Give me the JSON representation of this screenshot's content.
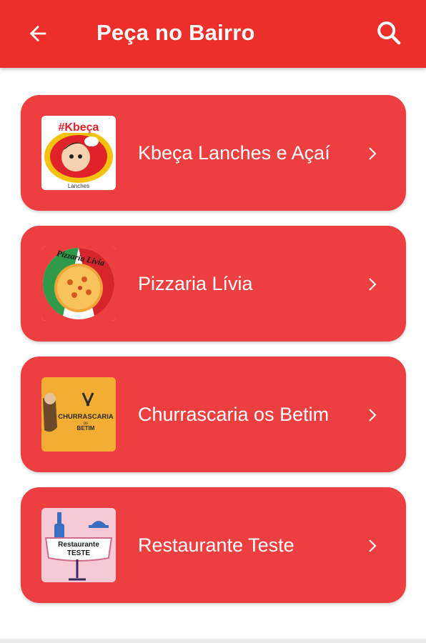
{
  "header": {
    "title": "Peça no Bairro",
    "back_icon": "arrow-left-icon",
    "search_icon": "search-icon",
    "background": "#ec2f2a"
  },
  "restaurants": [
    {
      "name": "Kbeça Lanches e Açaí",
      "logo_text": "#Kbeça",
      "logo_sub": "Lanches",
      "icon": "chevron-right-icon"
    },
    {
      "name": "Pizzaria Lívia",
      "logo_text": "Pizzaria Livia",
      "icon": "chevron-right-icon"
    },
    {
      "name": "Churrascaria os Betim",
      "logo_text": "CHURRASCARIA",
      "logo_mid": "os",
      "logo_sub": "BETIM",
      "icon": "chevron-right-icon"
    },
    {
      "name": "Restaurante Teste",
      "logo_text": "Restaurante",
      "logo_sub": "TESTE",
      "icon": "chevron-right-icon"
    }
  ],
  "colors": {
    "card": "#ee3f40",
    "text": "#ffffff"
  }
}
